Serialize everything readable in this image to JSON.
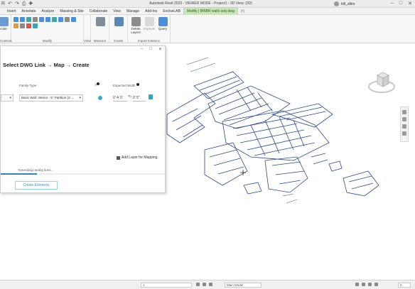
{
  "window": {
    "title": "Autodesk Revit 2023 - VIEWER MODE - Project1 - 3D View: {3D}",
    "user": "bill_allen",
    "quick_access_icons": [
      "app-menu-icon",
      "undo-icon",
      "redo-icon"
    ]
  },
  "ribbon": {
    "tabs": [
      {
        "label": "Insert"
      },
      {
        "label": "Annotate"
      },
      {
        "label": "Analyze"
      },
      {
        "label": "Massing & Site"
      },
      {
        "label": "Collaborate"
      },
      {
        "label": "View"
      },
      {
        "label": "Manage"
      },
      {
        "label": "Add-Ins"
      },
      {
        "label": "EvolveLAB"
      },
      {
        "label": "Modify | BWBR walls only.dwg"
      },
      {
        "label": "(•)"
      }
    ],
    "active_tab": "Modify | BWBR walls only.dwg",
    "groups": {
      "controls_label": "Controls",
      "clip_label": "icate",
      "modify_label": "Modify",
      "view_label": "View",
      "measure_label": "Measure",
      "create_label": "Create",
      "import_label": "Import Instance",
      "delete_layers": "Delete Layers",
      "explode": "Explode",
      "query": "Query"
    }
  },
  "dialog": {
    "title": "Select DWG Link → Map → Create",
    "family_type_label": "Family Type",
    "family_type_value": "Basic Wall: Interior - 5\" Partition (2-…",
    "layer_value": "",
    "f_label": "F",
    "expected_width_label": "Expected Width",
    "width_min": "0' 4 7/",
    "width_sep": "To",
    "width_max": "0' 5\"",
    "add_layer": "Add Layer for Mapping",
    "status": "Extending nearby lines...",
    "progress_percent": 22,
    "create_button": "Create Elements",
    "colors": {
      "accent": "#2f86b7",
      "dot": "#3ba9c9"
    }
  },
  "statusbar": {
    "scale": "1",
    "model": "Main Model",
    "zoom": "0"
  }
}
